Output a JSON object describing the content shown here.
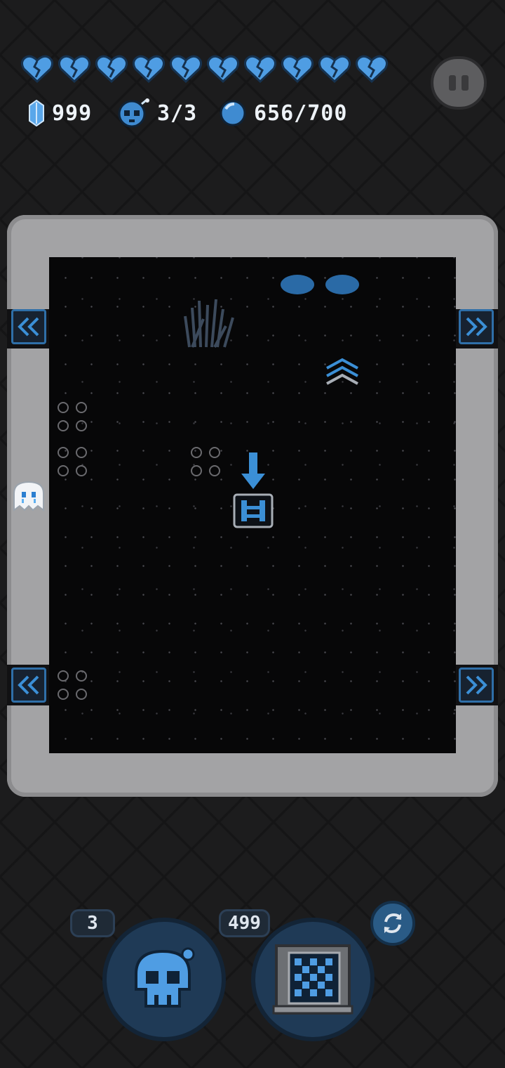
{
  "hud": {
    "hearts_count": 10,
    "crystals": "999",
    "bombs": "3/3",
    "energy": "656/700"
  },
  "controls": {
    "bomb_count": "3",
    "map_cost": "499"
  },
  "colors": {
    "accent": "#3b8fd6",
    "wall": "#a3a3a5",
    "floor": "#070708",
    "background": "#1c1c1d"
  },
  "icons": {
    "heart": "broken-heart-icon",
    "crystal": "crystal-icon",
    "bomb": "bomb-icon",
    "energy": "energy-orb-icon",
    "pause": "pause-icon",
    "skull": "skull-bomb-icon",
    "map": "map-grid-icon",
    "swap": "swap-icon"
  }
}
